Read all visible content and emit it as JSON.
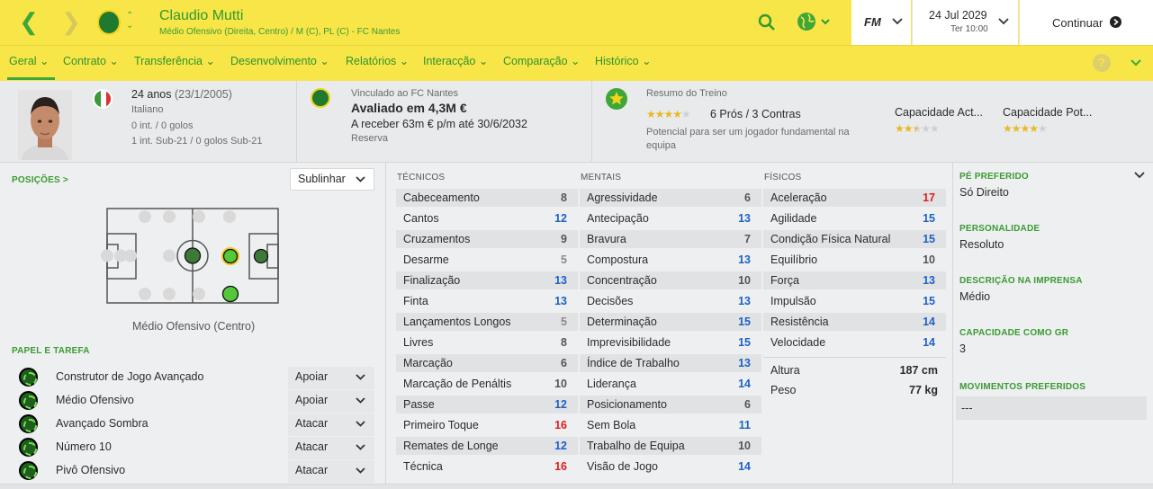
{
  "header": {
    "player_name": "Claudio Mutti",
    "player_sub": "Médio Ofensivo (Direita, Centro) / M (C), PL (C) - FC Nantes",
    "fm_label": "FM",
    "date": "24 Jul 2029",
    "day_time": "Ter 10:00",
    "continue_label": "Continuar"
  },
  "tabs": [
    "Geral",
    "Contrato",
    "Transferência",
    "Desenvolvimento",
    "Relatórios",
    "Interacção",
    "Comparação",
    "Histórico"
  ],
  "help_icon": "?",
  "info": {
    "age": "24 anos",
    "dob": "(23/1/2005)",
    "nationality": "Italiano",
    "caps": "0 int. / 0 golos",
    "u21": "1 int. Sub-21 / 0 golos Sub-21",
    "contract_line": "Vinculado ao FC Nantes",
    "value": "Avaliado em 4,3M €",
    "wage": "A receber 63m € p/m até 30/6/2032",
    "squad_status": "Reserva",
    "training_title": "Resumo do Treino",
    "pros_cons": "6 Prós / 3 Contras",
    "training_note": "Potencial para ser um jogador fundamental na equipa",
    "ca_label": "Capacidade Act...",
    "pa_label": "Capacidade Pot...",
    "ca_stars": 2.5,
    "pa_stars": 4,
    "training_stars": 4
  },
  "positions": {
    "title": "POSIÇÕES >",
    "highlight_button": "Sublinhar",
    "position_label": "Médio Ofensivo (Centro)"
  },
  "roles": {
    "title": "PAPEL E TAREFA",
    "items": [
      {
        "role": "Construtor de Jogo Avançado",
        "duty": "Apoiar"
      },
      {
        "role": "Médio Ofensivo",
        "duty": "Apoiar"
      },
      {
        "role": "Avançado Sombra",
        "duty": "Atacar"
      },
      {
        "role": "Número 10",
        "duty": "Atacar"
      },
      {
        "role": "Pivô Ofensivo",
        "duty": "Atacar"
      }
    ]
  },
  "attributes": {
    "technical_title": "TÉCNICOS",
    "mental_title": "MENTAIS",
    "physical_title": "FÍSICOS",
    "technical": [
      {
        "name": "Cabeceamento",
        "value": "8"
      },
      {
        "name": "Cantos",
        "value": "12"
      },
      {
        "name": "Cruzamentos",
        "value": "9"
      },
      {
        "name": "Desarme",
        "value": "5"
      },
      {
        "name": "Finalização",
        "value": "13"
      },
      {
        "name": "Finta",
        "value": "13"
      },
      {
        "name": "Lançamentos Longos",
        "value": "5"
      },
      {
        "name": "Livres",
        "value": "8"
      },
      {
        "name": "Marcação",
        "value": "6"
      },
      {
        "name": "Marcação de Penáltis",
        "value": "10"
      },
      {
        "name": "Passe",
        "value": "12"
      },
      {
        "name": "Primeiro Toque",
        "value": "16"
      },
      {
        "name": "Remates de Longe",
        "value": "12"
      },
      {
        "name": "Técnica",
        "value": "16"
      }
    ],
    "mental": [
      {
        "name": "Agressividade",
        "value": "6"
      },
      {
        "name": "Antecipação",
        "value": "13"
      },
      {
        "name": "Bravura",
        "value": "7"
      },
      {
        "name": "Compostura",
        "value": "13"
      },
      {
        "name": "Concentração",
        "value": "10"
      },
      {
        "name": "Decisões",
        "value": "13"
      },
      {
        "name": "Determinação",
        "value": "15"
      },
      {
        "name": "Imprevisibilidade",
        "value": "15"
      },
      {
        "name": "Índice de Trabalho",
        "value": "13"
      },
      {
        "name": "Liderança",
        "value": "14"
      },
      {
        "name": "Posicionamento",
        "value": "6"
      },
      {
        "name": "Sem Bola",
        "value": "11"
      },
      {
        "name": "Trabalho de Equipa",
        "value": "10"
      },
      {
        "name": "Visão de Jogo",
        "value": "14"
      }
    ],
    "physical": [
      {
        "name": "Aceleração",
        "value": "17"
      },
      {
        "name": "Agilidade",
        "value": "15"
      },
      {
        "name": "Condição Física Natural",
        "value": "15"
      },
      {
        "name": "Equilíbrio",
        "value": "10"
      },
      {
        "name": "Força",
        "value": "13"
      },
      {
        "name": "Impulsão",
        "value": "15"
      },
      {
        "name": "Resistência",
        "value": "14"
      },
      {
        "name": "Velocidade",
        "value": "14"
      }
    ],
    "height_label": "Altura",
    "height": "187 cm",
    "weight_label": "Peso",
    "weight": "77 kg"
  },
  "details": {
    "foot_title": "PÉ PREFERIDO",
    "foot": "Só Direito",
    "personality_title": "PERSONALIDADE",
    "personality": "Resoluto",
    "media_title": "DESCRIÇÃO NA IMPRENSA",
    "media": "Médio",
    "gk_title": "CAPACIDADE COMO GR",
    "gk": "3",
    "moves_title": "MOVIMENTOS PREFERIDOS",
    "moves": "---"
  },
  "colors": {
    "accent": "#f8e548",
    "green": "#3fa73a",
    "high": "#e11d1d",
    "good": "#1c61c6"
  }
}
